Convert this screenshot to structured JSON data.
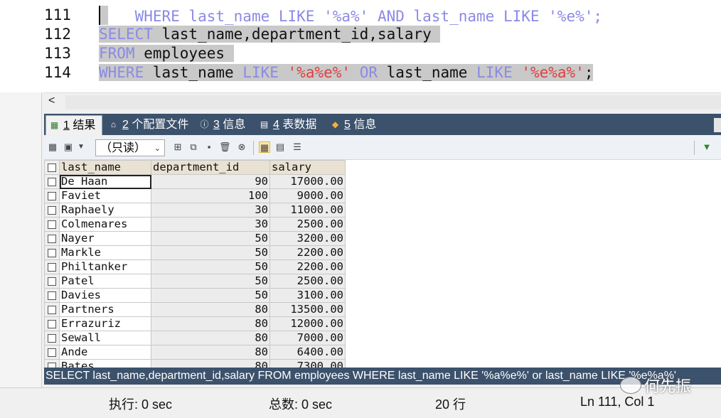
{
  "editor": {
    "partial_line": "WHERE last_name LIKE '%a%' AND last_name LIKE '%e%';",
    "lines": [
      {
        "num": "111"
      },
      {
        "num": "112",
        "parts": [
          {
            "t": "kw",
            "v": "SELECT"
          },
          {
            "t": "pl",
            "v": " last_name,department_id,salary "
          }
        ]
      },
      {
        "num": "113",
        "parts": [
          {
            "t": "kw",
            "v": "FROM"
          },
          {
            "t": "pl",
            "v": " employees "
          }
        ]
      },
      {
        "num": "114",
        "parts": [
          {
            "t": "kw",
            "v": "WHERE"
          },
          {
            "t": "pl",
            "v": " last_name "
          },
          {
            "t": "kw",
            "v": "LIKE"
          },
          {
            "t": "pl",
            "v": " "
          },
          {
            "t": "str",
            "v": "'%a%e%'"
          },
          {
            "t": "pl",
            "v": " "
          },
          {
            "t": "kw",
            "v": "OR"
          },
          {
            "t": "pl",
            "v": " last_name "
          },
          {
            "t": "kw",
            "v": "LIKE"
          },
          {
            "t": "pl",
            "v": " "
          },
          {
            "t": "str",
            "v": "'%e%a%'"
          },
          {
            "t": "pl",
            "v": ";"
          }
        ]
      }
    ],
    "scroll_left": "<"
  },
  "tabs": [
    {
      "num": "1",
      "label": "结果",
      "icon": "grid-result-icon",
      "active": true
    },
    {
      "num": "2",
      "label": "个配置文件",
      "icon": "profile-icon",
      "active": false
    },
    {
      "num": "3",
      "label": "信息",
      "icon": "info-icon",
      "active": false
    },
    {
      "num": "4",
      "label": "表数据",
      "icon": "table-data-icon",
      "active": false
    },
    {
      "num": "5",
      "label": "信息",
      "icon": "info-icon-2",
      "active": false
    }
  ],
  "toolbar": {
    "mode": "（只读）"
  },
  "grid": {
    "columns": [
      "last_name",
      "department_id",
      "salary"
    ],
    "rows": [
      [
        "De Haan",
        "90",
        "17000.00"
      ],
      [
        "Faviet",
        "100",
        "9000.00"
      ],
      [
        "Raphaely",
        "30",
        "11000.00"
      ],
      [
        "Colmenares",
        "30",
        "2500.00"
      ],
      [
        "Nayer",
        "50",
        "3200.00"
      ],
      [
        "Markle",
        "50",
        "2200.00"
      ],
      [
        "Philtanker",
        "50",
        "2200.00"
      ],
      [
        "Patel",
        "50",
        "2500.00"
      ],
      [
        "Davies",
        "50",
        "3100.00"
      ],
      [
        "Partners",
        "80",
        "13500.00"
      ],
      [
        "Errazuriz",
        "80",
        "12000.00"
      ],
      [
        "Sewall",
        "80",
        "7000.00"
      ],
      [
        "Ande",
        "80",
        "6400.00"
      ],
      [
        "Bates",
        "80",
        "7300.00"
      ]
    ]
  },
  "sql_status": "SELECT last_name,department_id,salary FROM employees WHERE last_name LIKE '%a%e%' or last_name LIKE '%e%a%'",
  "status": {
    "exec_time": "执行: 0 sec",
    "total_time": "总数: 0 sec",
    "rows": "20 行",
    "cursor": "Ln 111, Col 1"
  },
  "watermark": "何先振"
}
